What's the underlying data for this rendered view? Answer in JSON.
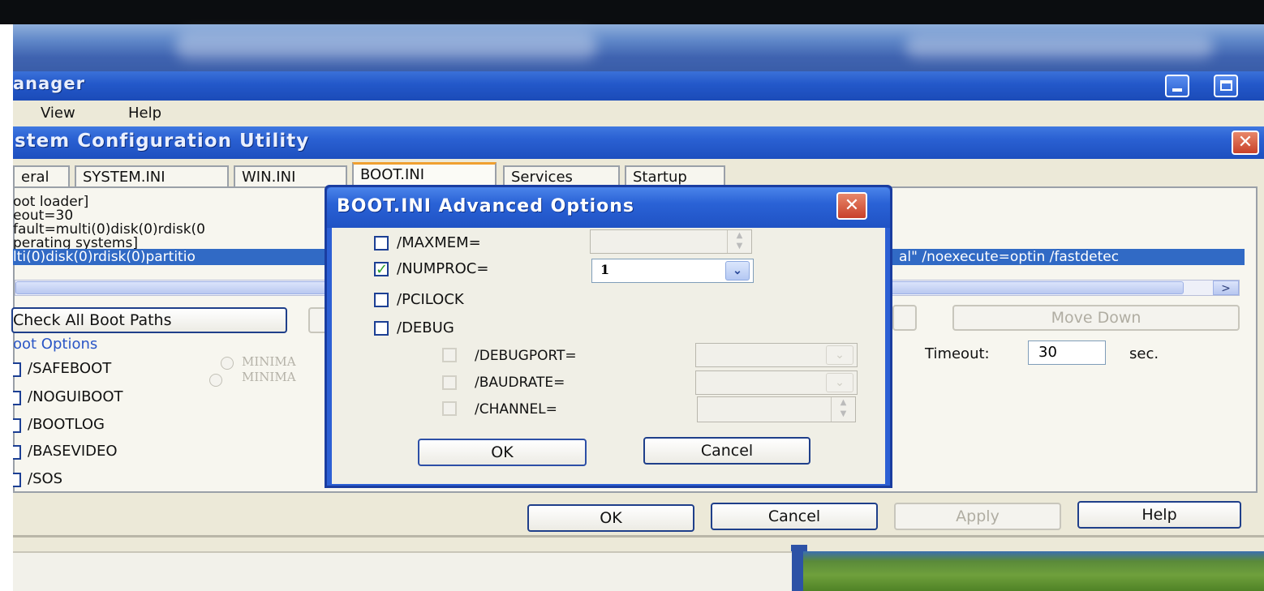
{
  "task_manager": {
    "title": "anager",
    "menu": [
      "View",
      "Help"
    ]
  },
  "scu": {
    "title": "stem Configuration Utility",
    "tabs": [
      "eral",
      "SYSTEM.INI",
      "WIN.INI",
      "BOOT.INI",
      "Services",
      "Startup"
    ],
    "boot_lines": [
      "oot loader]",
      "eout=30",
      "fault=multi(0)disk(0)rdisk(0",
      "perating systems]"
    ],
    "selected_line_left": "lti(0)disk(0)rdisk(0)partitio",
    "selected_line_right": "al\" /noexecute=optin /fastdetec",
    "check_all_button": "Check All Boot Paths",
    "move_down_button": "Move Down",
    "boot_options_label": "oot Options",
    "options": [
      "/SAFEBOOT",
      "/NOGUIBOOT",
      "/BOOTLOG",
      "/BASEVIDEO",
      "/SOS"
    ],
    "radio_labels": [
      "MINIMA",
      "MINIMA"
    ],
    "timeout_label": "Timeout:",
    "timeout_value": "30",
    "timeout_unit": "sec.",
    "buttons": {
      "ok": "OK",
      "cancel": "Cancel",
      "apply": "Apply",
      "help": "Help"
    }
  },
  "advanced": {
    "title": "BOOT.INI Advanced Options",
    "maxmem_label": "/MAXMEM=",
    "numproc_label": "/NUMPROC=",
    "numproc_value": "1",
    "pcilock_label": "/PCILOCK",
    "debug_label": "/DEBUG",
    "debugport_label": "/DEBUGPORT=",
    "baudrate_label": "/BAUDRATE=",
    "channel_label": "/CHANNEL=",
    "ok": "OK",
    "cancel": "Cancel",
    "numproc_checked": true
  }
}
